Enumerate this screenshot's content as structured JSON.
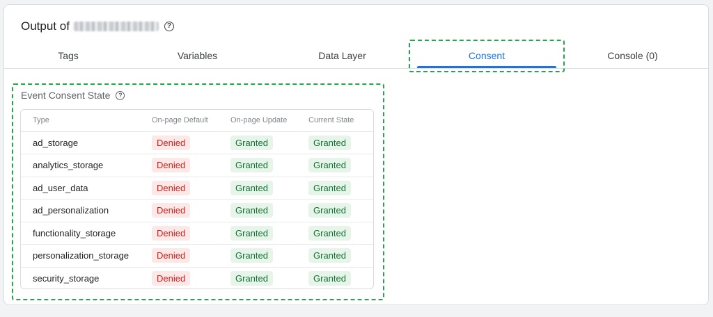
{
  "header": {
    "title_prefix": "Output of"
  },
  "tabs": [
    {
      "label": "Tags"
    },
    {
      "label": "Variables"
    },
    {
      "label": "Data Layer"
    },
    {
      "label": "Consent"
    },
    {
      "label": "Console (0)"
    }
  ],
  "active_tab": "Consent",
  "section": {
    "title": "Event Consent State",
    "columns": [
      "Type",
      "On-page Default",
      "On-page Update",
      "Current State"
    ],
    "rows": [
      {
        "type": "ad_storage",
        "default": "Denied",
        "update": "Granted",
        "current": "Granted"
      },
      {
        "type": "analytics_storage",
        "default": "Denied",
        "update": "Granted",
        "current": "Granted"
      },
      {
        "type": "ad_user_data",
        "default": "Denied",
        "update": "Granted",
        "current": "Granted"
      },
      {
        "type": "ad_personalization",
        "default": "Denied",
        "update": "Granted",
        "current": "Granted"
      },
      {
        "type": "functionality_storage",
        "default": "Denied",
        "update": "Granted",
        "current": "Granted"
      },
      {
        "type": "personalization_storage",
        "default": "Denied",
        "update": "Granted",
        "current": "Granted"
      },
      {
        "type": "security_storage",
        "default": "Denied",
        "update": "Granted",
        "current": "Granted"
      }
    ]
  },
  "colors": {
    "accent": "#1a73e8",
    "denied_bg": "#fce8e6",
    "denied_text": "#c5221f",
    "granted_bg": "#e6f4ea",
    "granted_text": "#137333",
    "highlight": "#1fa94a"
  },
  "icons": {
    "help": "help-circle-icon"
  }
}
